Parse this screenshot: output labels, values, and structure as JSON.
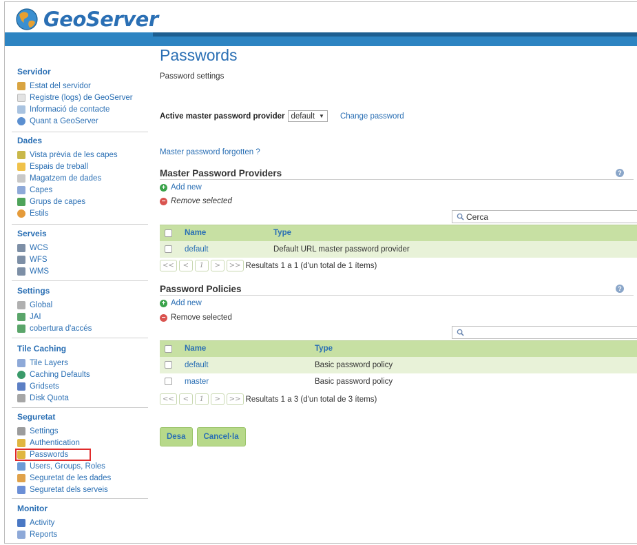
{
  "header": {
    "logo_text": "GeoServer"
  },
  "sidebar": {
    "sections": [
      {
        "title": "Servidor",
        "items": [
          "Estat del servidor",
          "Registre (logs) de GeoServer",
          "Informació de contacte",
          "Quant a GeoServer"
        ]
      },
      {
        "title": "Dades",
        "items": [
          "Vista prèvia de les capes",
          "Espais de treball",
          "Magatzem de dades",
          "Capes",
          "Grups de capes",
          "Estils"
        ]
      },
      {
        "title": "Serveis",
        "items": [
          "WCS",
          "WFS",
          "WMS"
        ]
      },
      {
        "title": "Settings",
        "items": [
          "Global",
          "JAI",
          "cobertura d'accés"
        ]
      },
      {
        "title": "Tile Caching",
        "items": [
          "Tile Layers",
          "Caching Defaults",
          "Gridsets",
          "Disk Quota"
        ]
      },
      {
        "title": "Seguretat",
        "items": [
          "Settings",
          "Authentication",
          "Passwords",
          "Users, Groups, Roles",
          "Seguretat de les dades",
          "Seguretat dels serveis"
        ]
      },
      {
        "title": "Monitor",
        "items": [
          "Activity",
          "Reports"
        ]
      }
    ],
    "highlighted_item": "Passwords"
  },
  "main": {
    "title": "Passwords",
    "description": "Password settings",
    "provider_label": "Active master password provider",
    "provider_value": "default",
    "change_password": "Change password",
    "forgot_link": "Master password forgotten ?",
    "master_providers": {
      "heading": "Master Password Providers",
      "add_new": "Add new",
      "remove_selected": "Remove selected",
      "search_placeholder": "Cerca",
      "columns": [
        "Name",
        "Type"
      ],
      "rows": [
        {
          "name": "default",
          "type": "Default URL master password provider"
        }
      ],
      "pager_buttons": [
        "<<",
        "<",
        "1",
        ">",
        ">>"
      ],
      "pager_text": "Resultats 1 a 1 (d'un total de 1 ítems)"
    },
    "password_policies": {
      "heading": "Password Policies",
      "add_new": "Add new",
      "remove_selected": "Remove selected",
      "search_placeholder": "",
      "columns": [
        "Name",
        "Type"
      ],
      "rows": [
        {
          "name": "default",
          "type": "Basic password policy"
        },
        {
          "name": "master",
          "type": "Basic password policy"
        }
      ],
      "pager_buttons": [
        "<<",
        "<",
        "1",
        ">",
        ">>"
      ],
      "pager_text": "Resultats 1 a 3 (d'un total de 3 ítems)"
    },
    "save_label": "Desa",
    "cancel_label": "Cancel·la"
  },
  "colors": {
    "accent": "#2a6fb4",
    "topbar": "#2d84c2",
    "table_header": "#c7e0a3",
    "row_odd": "#e8f2d8",
    "highlight": "#e02b2b"
  }
}
